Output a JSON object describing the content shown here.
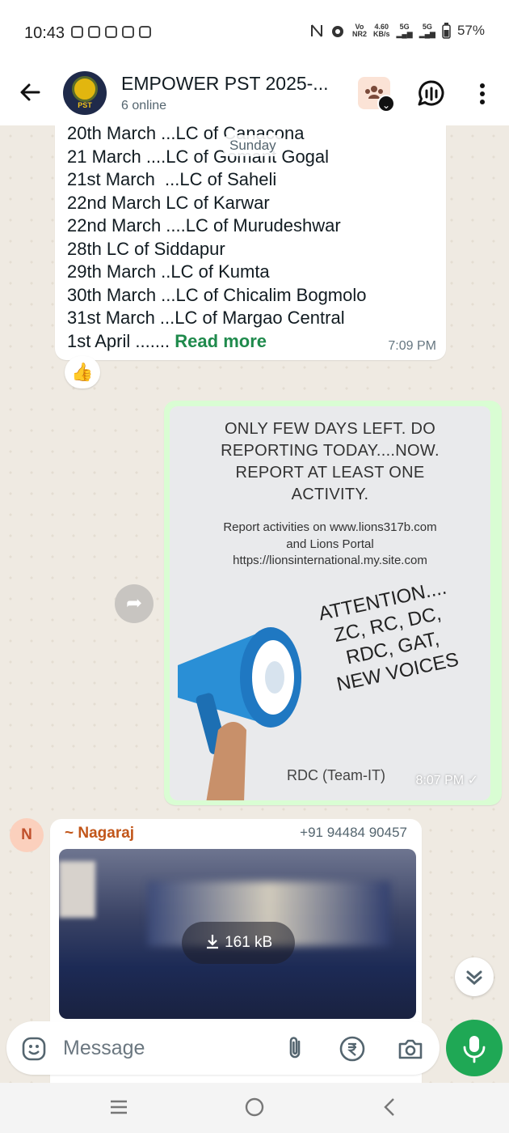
{
  "status_bar": {
    "time": "10:43",
    "volte": "Vo",
    "nr": "NR2",
    "speed_value": "4.60",
    "speed_unit": "KB/s",
    "net1": "5G",
    "net2": "5G",
    "battery": "57%"
  },
  "header": {
    "title": "EMPOWER PST 2025-...",
    "subtitle": "6 online",
    "avatar_text": "PST"
  },
  "messages": {
    "incoming1": {
      "lines": [
        "20th March ...LC of Canacona",
        "21 March ....LC of Gomant Gogal",
        "21st March  ...LC of Saheli",
        "22nd March LC of Karwar",
        "22nd March ....LC of Murudeshwar",
        "28th LC of Siddapur",
        "29th March ..LC of Kumta",
        "30th March ...LC of Chicalim Bogmolo",
        "31st March ...LC of Margao Central"
      ],
      "last_line": "1st April ....... ",
      "read_more": "Read more",
      "time": "7:09 PM",
      "reaction": "👍"
    },
    "date_chip": "Sunday",
    "outgoing": {
      "poster_heading": [
        "ONLY FEW DAYS LEFT. DO",
        "REPORTING TODAY....NOW.",
        "REPORT AT LEAST ONE",
        "ACTIVITY."
      ],
      "poster_sub": [
        "Report activities on www.lions317b.com",
        "and Lions Portal",
        "https://lionsinternational.my.site.com"
      ],
      "poster_attention": [
        "ATTENTION....",
        "ZC, RC, DC,",
        "RDC, GAT,",
        "NEW VOICES"
      ],
      "poster_credit": "RDC (Team-IT)",
      "time": "8:07 PM",
      "tick": "✓"
    },
    "incoming2": {
      "avatar_initial": "N",
      "sender": "~ Nagaraj",
      "phone": "+91 94484 90457",
      "download_size": "161 kB"
    }
  },
  "composer": {
    "placeholder": "Message"
  },
  "colors": {
    "accent_green": "#1fa855",
    "outgoing_bubble": "#d9fdd3",
    "chat_background": "#efeae2"
  }
}
